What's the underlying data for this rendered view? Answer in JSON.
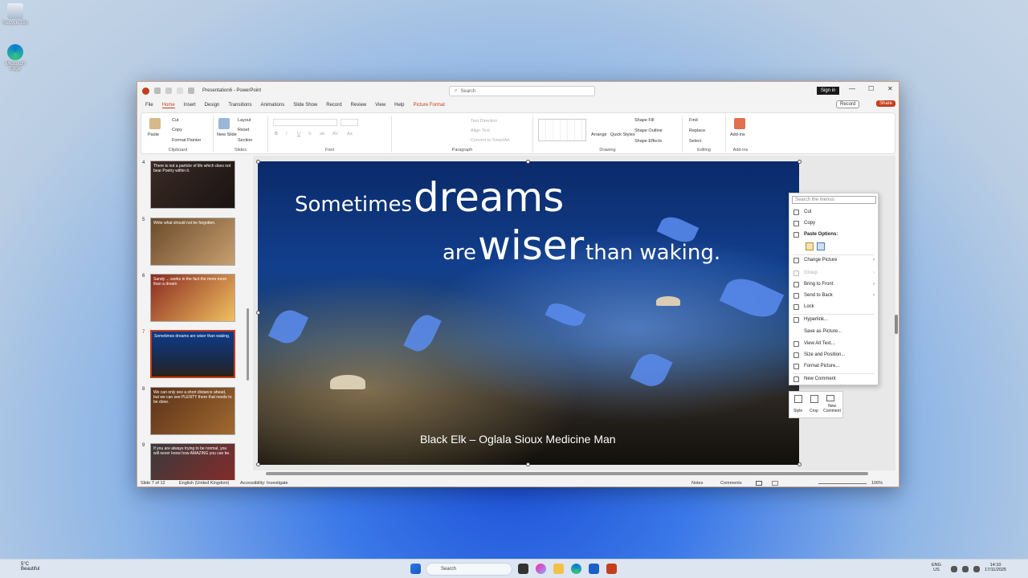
{
  "desktop": {
    "icons": [
      {
        "label": "Recycle Bin"
      },
      {
        "label": "Microsoft Edge"
      }
    ]
  },
  "window": {
    "doc_title": "Presentation6  -  PowerPoint",
    "search_placeholder": "Search",
    "signin_label": "Sign in",
    "controls": {
      "min": "—",
      "max": "☐",
      "close": "✕"
    },
    "menu_tabs": [
      "File",
      "Home",
      "Insert",
      "Design",
      "Transitions",
      "Animations",
      "Slide Show",
      "Record",
      "Review",
      "View",
      "Help",
      "Picture Format"
    ],
    "record_label": "Record",
    "share_label": "Share"
  },
  "ribbon": {
    "clipboard": {
      "paste": "Paste",
      "cut": "Cut",
      "copy": "Copy",
      "format_painter": "Format Painter",
      "label": "Clipboard"
    },
    "slides": {
      "new_slide": "New Slide",
      "layout": "Layout",
      "reset": "Reset",
      "section": "Section",
      "label": "Slides"
    },
    "font": {
      "label": "Font",
      "bold": "B",
      "italic": "I",
      "underline": "U",
      "strike": "S",
      "shadow": "ab",
      "spacing": "AV",
      "case": "Aa"
    },
    "paragraph": {
      "text_direction": "Text Direction",
      "align_text": "Align Text",
      "smartart": "Convert to SmartArt",
      "label": "Paragraph"
    },
    "drawing": {
      "arrange": "Arrange",
      "quick_styles": "Quick Styles",
      "shape_fill": "Shape Fill",
      "shape_outline": "Shape Outline",
      "shape_effects": "Shape Effects",
      "label": "Drawing"
    },
    "editing": {
      "find": "Find",
      "replace": "Replace",
      "select": "Select",
      "label": "Editing"
    },
    "addins": {
      "button": "Add-ins",
      "label": "Add-ins"
    }
  },
  "thumbnails": [
    {
      "num": "4",
      "text": "There is not a particle of life which does not bear Poetry within it."
    },
    {
      "num": "5",
      "text": "Write what should not be forgotten."
    },
    {
      "num": "6",
      "text": "Sandy ... works in the fact the more more than a dream"
    },
    {
      "num": "7",
      "text": "Sometimes dreams are wiser than waking."
    },
    {
      "num": "8",
      "text": "We can only see a short distance ahead, but we can see PLENTY there that needs to be done."
    },
    {
      "num": "9",
      "text": "If you are always trying to be normal, you will never know how AMAZING you can be."
    }
  ],
  "slide": {
    "line1_small": "Sometimes",
    "line1_big": "dreams",
    "line2_small": "are",
    "line2_big": "wiser",
    "line2_end": "than waking.",
    "credit": "Black Elk – Oglala Sioux Medicine Man"
  },
  "context_menu": {
    "search_placeholder": "Search the menus",
    "items": [
      {
        "label": "Cut",
        "enabled": true
      },
      {
        "label": "Copy",
        "enabled": true
      },
      {
        "label": "Paste Options:",
        "enabled": true
      },
      {
        "label": "Change Picture",
        "enabled": true,
        "submenu": true
      },
      {
        "label": "Group",
        "enabled": false,
        "submenu": true
      },
      {
        "label": "Bring to Front",
        "enabled": true,
        "submenu": true
      },
      {
        "label": "Send to Back",
        "enabled": true,
        "submenu": true
      },
      {
        "label": "Lock",
        "enabled": true
      },
      {
        "label": "Hyperlink...",
        "enabled": true
      },
      {
        "label": "Save as Picture...",
        "enabled": true
      },
      {
        "label": "View Alt Text...",
        "enabled": true
      },
      {
        "label": "Size and Position...",
        "enabled": true
      },
      {
        "label": "Format Picture...",
        "enabled": true
      },
      {
        "label": "New Comment",
        "enabled": true
      }
    ],
    "minibar": {
      "style": "Style",
      "crop": "Crop",
      "new_comment": "New Comment"
    }
  },
  "status": {
    "slide": "Slide 7 of 12",
    "language": "English (United Kingdom)",
    "accessibility": "Accessibility: Investigate",
    "notes": "Notes",
    "comments": "Comments",
    "zoom": "106%"
  },
  "taskbar": {
    "weather_temp": "5°C",
    "weather_desc": "Beautiful",
    "search": "Search",
    "lang": "ENG",
    "region": "US",
    "time": "14:10",
    "date": "17/11/2025"
  },
  "colors": {
    "accent": "#c43e1c",
    "selection": "#c43e1c"
  }
}
